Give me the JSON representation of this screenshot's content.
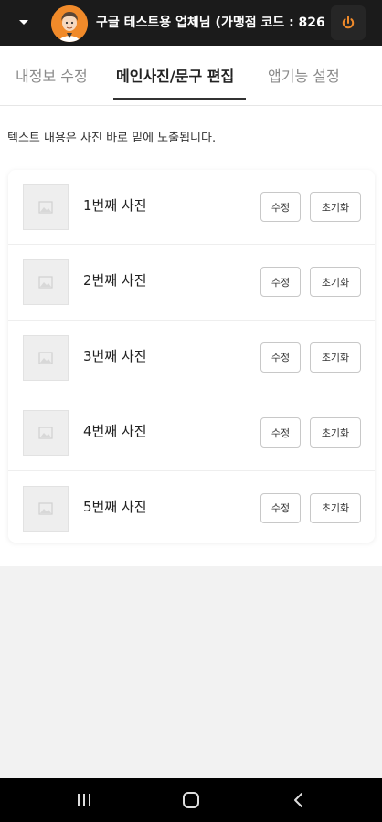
{
  "header": {
    "store_name": "구글 테스트용 업체님 (가맹점 코드 : 826...",
    "dropdown_icon": "caret-down-icon",
    "avatar_icon": "avatar-icon",
    "power_icon": "power-icon",
    "accent_color": "#f08a2a"
  },
  "tabs": [
    {
      "label": "내정보 수정"
    },
    {
      "label": "메인사진/문구 편집"
    },
    {
      "label": "앱기능 설정"
    }
  ],
  "active_tab": "메인사진/문구 편집",
  "notice": "텍스트 내용은 사진 바로 밑에 노출됩니다.",
  "photos": [
    {
      "label": "1번째 사진",
      "edit_label": "수정",
      "reset_label": "초기화"
    },
    {
      "label": "2번째 사진",
      "edit_label": "수정",
      "reset_label": "초기화"
    },
    {
      "label": "3번째 사진",
      "edit_label": "수정",
      "reset_label": "초기화"
    },
    {
      "label": "4번째 사진",
      "edit_label": "수정",
      "reset_label": "초기화"
    },
    {
      "label": "5번째 사진",
      "edit_label": "수정",
      "reset_label": "초기화"
    }
  ],
  "system_nav": {
    "recents_icon": "recents-icon",
    "home_icon": "home-icon",
    "back_icon": "back-icon"
  }
}
